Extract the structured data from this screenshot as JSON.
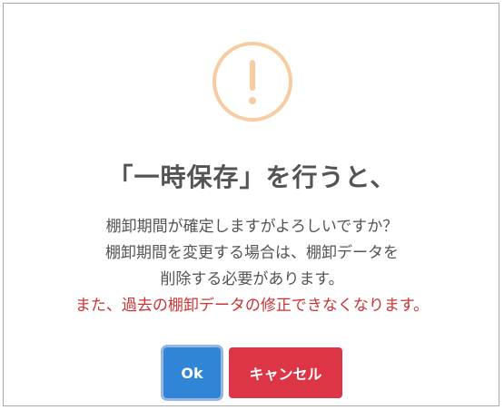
{
  "dialog": {
    "icon": "warning-exclamation-icon",
    "icon_color": "#f8cca3",
    "title": "「一時保存」を行うと、",
    "message_lines": [
      "棚卸期間が確定しますがよろしいですか？",
      "棚卸期間を変更する場合は、棚卸データを",
      "削除する必要があります。"
    ],
    "warning_line": "また、過去の棚卸データの修正できなくなります。",
    "warning_color": "#cc3333",
    "buttons": {
      "ok_label": "Ok",
      "ok_color": "#3085d6",
      "cancel_label": "キャンセル",
      "cancel_color": "#dc3545"
    }
  }
}
